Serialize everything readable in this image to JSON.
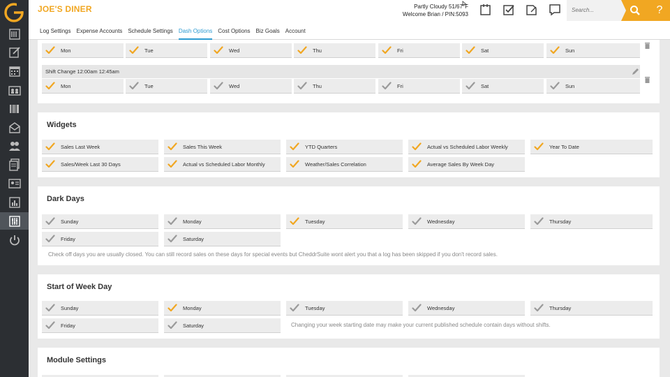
{
  "app": {
    "restaurant_name": "JOE'S DINER",
    "weather": "Partly Cloudy 51/67°F",
    "welcome": "Welcome Brian / PIN:5093",
    "search_placeholder": "Search...",
    "help_label": "?",
    "accent_color": "#f1a722",
    "link_color": "#2c9ad1"
  },
  "nav_tabs": [
    {
      "label": "Log Settings"
    },
    {
      "label": "Expense Accounts"
    },
    {
      "label": "Schedule Settings"
    },
    {
      "label": "Dash Options",
      "active": true
    },
    {
      "label": "Cost Options"
    },
    {
      "label": "Biz Goals"
    },
    {
      "label": "Account"
    }
  ],
  "shifts": {
    "row1_days": [
      {
        "label": "Mon",
        "checked": true
      },
      {
        "label": "Tue",
        "checked": true
      },
      {
        "label": "Wed",
        "checked": true
      },
      {
        "label": "Thu",
        "checked": true
      },
      {
        "label": "Fri",
        "checked": true
      },
      {
        "label": "Sat",
        "checked": true
      },
      {
        "label": "Sun",
        "checked": true
      }
    ],
    "shift_change_label": "Shift Change 12:00am 12:45am",
    "row2_days": [
      {
        "label": "Mon",
        "checked": true
      },
      {
        "label": "Tue",
        "checked": false
      },
      {
        "label": "Wed",
        "checked": false
      },
      {
        "label": "Thu",
        "checked": false
      },
      {
        "label": "Fri",
        "checked": false
      },
      {
        "label": "Sat",
        "checked": false
      },
      {
        "label": "Sun",
        "checked": false
      }
    ]
  },
  "widgets": {
    "title": "Widgets",
    "items": [
      {
        "label": "Sales Last Week",
        "checked": true
      },
      {
        "label": "Sales This Week",
        "checked": true
      },
      {
        "label": "YTD Quarters",
        "checked": true
      },
      {
        "label": "Actual vs Scheduled Labor Weekly",
        "checked": true
      },
      {
        "label": "Year To Date",
        "checked": true
      },
      {
        "label": "Sales/Week Last 30 Days",
        "checked": true
      },
      {
        "label": "Actual vs Scheduled Labor Monthly",
        "checked": true
      },
      {
        "label": "Weather/Sales Correlation",
        "checked": true
      },
      {
        "label": "Average Sales By Week Day",
        "checked": true
      }
    ]
  },
  "dark_days": {
    "title": "Dark Days",
    "items": [
      {
        "label": "Sunday",
        "checked": false
      },
      {
        "label": "Monday",
        "checked": false
      },
      {
        "label": "Tuesday",
        "checked": true
      },
      {
        "label": "Wednesday",
        "checked": false
      },
      {
        "label": "Thursday",
        "checked": false
      },
      {
        "label": "Friday",
        "checked": false
      },
      {
        "label": "Saturday",
        "checked": false
      }
    ],
    "note": "Check off days you are usually closed. You can still record sales on these days for special events but CheddrSuite wont alert you that a log has been skipped if you don't record sales."
  },
  "start_of_week": {
    "title": "Start of Week Day",
    "items": [
      {
        "label": "Sunday",
        "checked": false
      },
      {
        "label": "Monday",
        "checked": true
      },
      {
        "label": "Tuesday",
        "checked": false
      },
      {
        "label": "Wednesday",
        "checked": false
      },
      {
        "label": "Thursday",
        "checked": false
      },
      {
        "label": "Friday",
        "checked": false
      },
      {
        "label": "Saturday",
        "checked": false
      }
    ],
    "note": "Changing your week starting date may make your current published schedule contain days without shifts."
  },
  "module_settings": {
    "title": "Module Settings"
  },
  "sidebar_icons": [
    "register-icon",
    "edit-log-icon",
    "calendar-icon",
    "schedule-icon",
    "inventory-icon",
    "mail-icon",
    "team-icon",
    "documents-icon",
    "id-card-icon",
    "reports-chart-icon",
    "settings-sliders-icon",
    "power-icon"
  ]
}
